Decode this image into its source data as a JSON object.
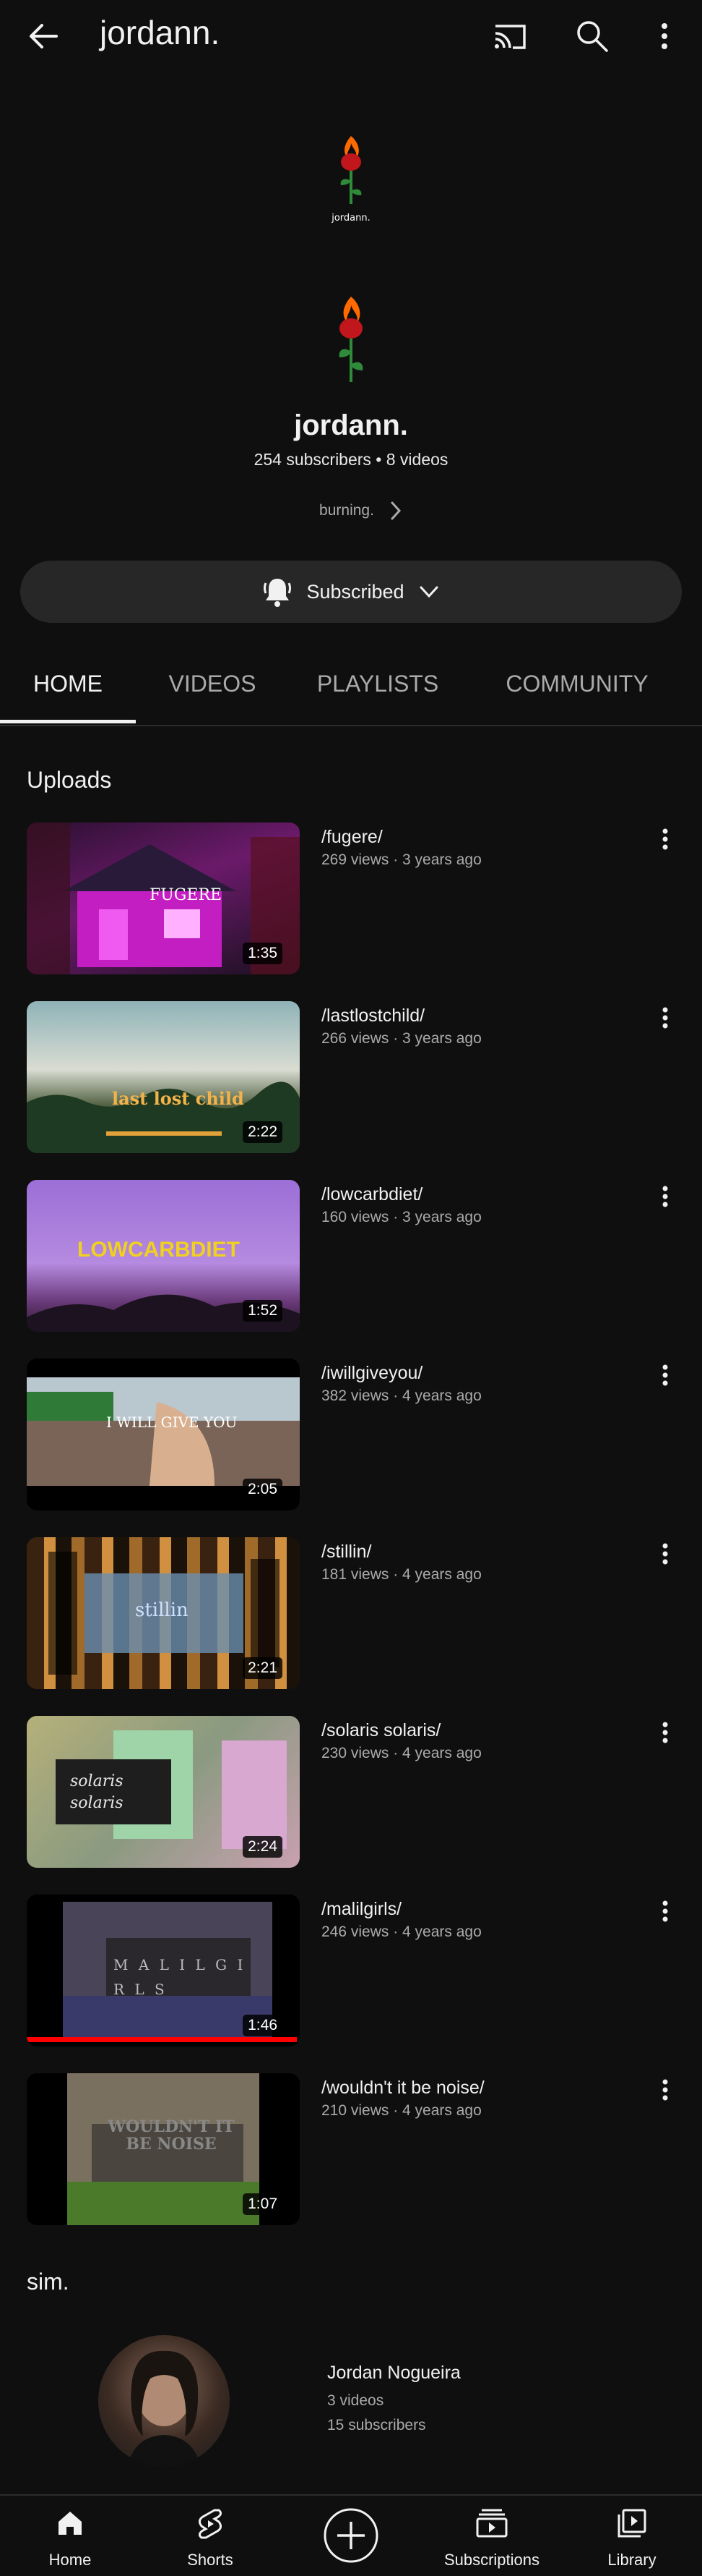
{
  "header": {
    "title": "jordann."
  },
  "channel": {
    "banner_caption": "jordann.",
    "name": "jordann.",
    "stats": "254 subscribers • 8 videos",
    "description": "burning.",
    "subscribe_label": "Subscribed"
  },
  "tabs": [
    "HOME",
    "VIDEOS",
    "PLAYLISTS",
    "COMMUNITY"
  ],
  "uploads": {
    "title": "Uploads",
    "videos": [
      {
        "title": "/fugere/",
        "meta": "269 views · 3 years ago",
        "duration": "1:35",
        "thumb_text": "FUGERE"
      },
      {
        "title": "/lastlostchild/",
        "meta": "266 views · 3 years ago",
        "duration": "2:22",
        "thumb_text": "last lost child"
      },
      {
        "title": "/lowcarbdiet/",
        "meta": "160 views · 3 years ago",
        "duration": "1:52",
        "thumb_text": "LOWCARBDIET"
      },
      {
        "title": "/iwillgiveyou/",
        "meta": "382 views · 4 years ago",
        "duration": "2:05",
        "thumb_text": "I WILL GIVE YOU"
      },
      {
        "title": "/stillin/",
        "meta": "181 views · 4 years ago",
        "duration": "2:21",
        "thumb_text": "stillin"
      },
      {
        "title": "/solaris solaris/",
        "meta": "230 views · 4 years ago",
        "duration": "2:24",
        "thumb_text": "solaris solaris"
      },
      {
        "title": "/malilgirls/",
        "meta": "246 views · 4 years ago",
        "duration": "1:46",
        "thumb_text": "M A L I L G I R L S",
        "progress": 0.99
      },
      {
        "title": "/wouldn't it be noise/",
        "meta": "210 views · 4 years ago",
        "duration": "1:07",
        "thumb_text": "WOULDN'T IT BE NOISE"
      }
    ]
  },
  "featured": {
    "title": "sim.",
    "channel_name": "Jordan Nogueira",
    "videos": "3 videos",
    "subscribers": "15 subscribers"
  },
  "nav": [
    "Home",
    "Shorts",
    "Subscriptions",
    "Library"
  ],
  "colors": {
    "background": "#0f0f0f",
    "surface": "#272727",
    "accent": "#ff0000",
    "secondary_text": "#aaaaaa"
  }
}
